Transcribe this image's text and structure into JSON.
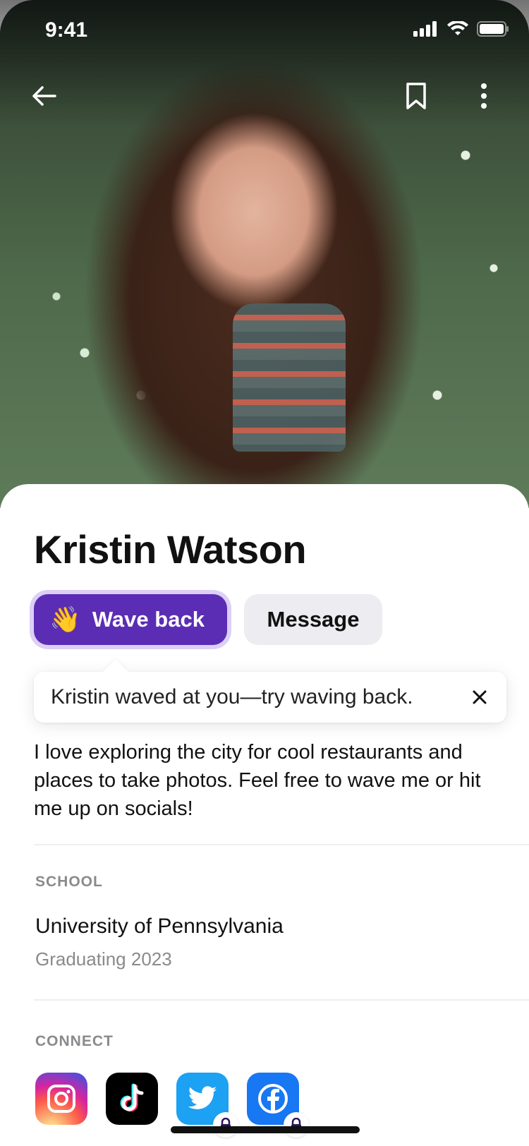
{
  "status_bar": {
    "time": "9:41"
  },
  "nav": {
    "back_icon": "arrow-left-icon",
    "bookmark_icon": "bookmark-icon",
    "more_icon": "more-vertical-icon"
  },
  "profile": {
    "name": "Kristin Watson",
    "wave_button": {
      "emoji": "👋",
      "label": "Wave back"
    },
    "message_button": {
      "label": "Message"
    },
    "tooltip": {
      "text": "Kristin waved at you—try waving back."
    },
    "bio": "I love exploring the city for cool restaurants and places to take photos. Feel free to wave me or hit me up on socials!"
  },
  "school": {
    "section_label": "SCHOOL",
    "name": "University of Pennsylvania",
    "subtitle": "Graduating 2023"
  },
  "connect": {
    "section_label": "CONNECT",
    "items": [
      {
        "icon": "instagram-icon",
        "locked": false
      },
      {
        "icon": "tiktok-icon",
        "locked": false
      },
      {
        "icon": "twitter-icon",
        "locked": true
      },
      {
        "icon": "facebook-icon",
        "locked": true
      }
    ]
  },
  "colors": {
    "accent": "#5b2db4",
    "accent_ring": "#dcd0f5",
    "secondary_button": "#ececf1",
    "muted_text": "#8a8a8e"
  }
}
